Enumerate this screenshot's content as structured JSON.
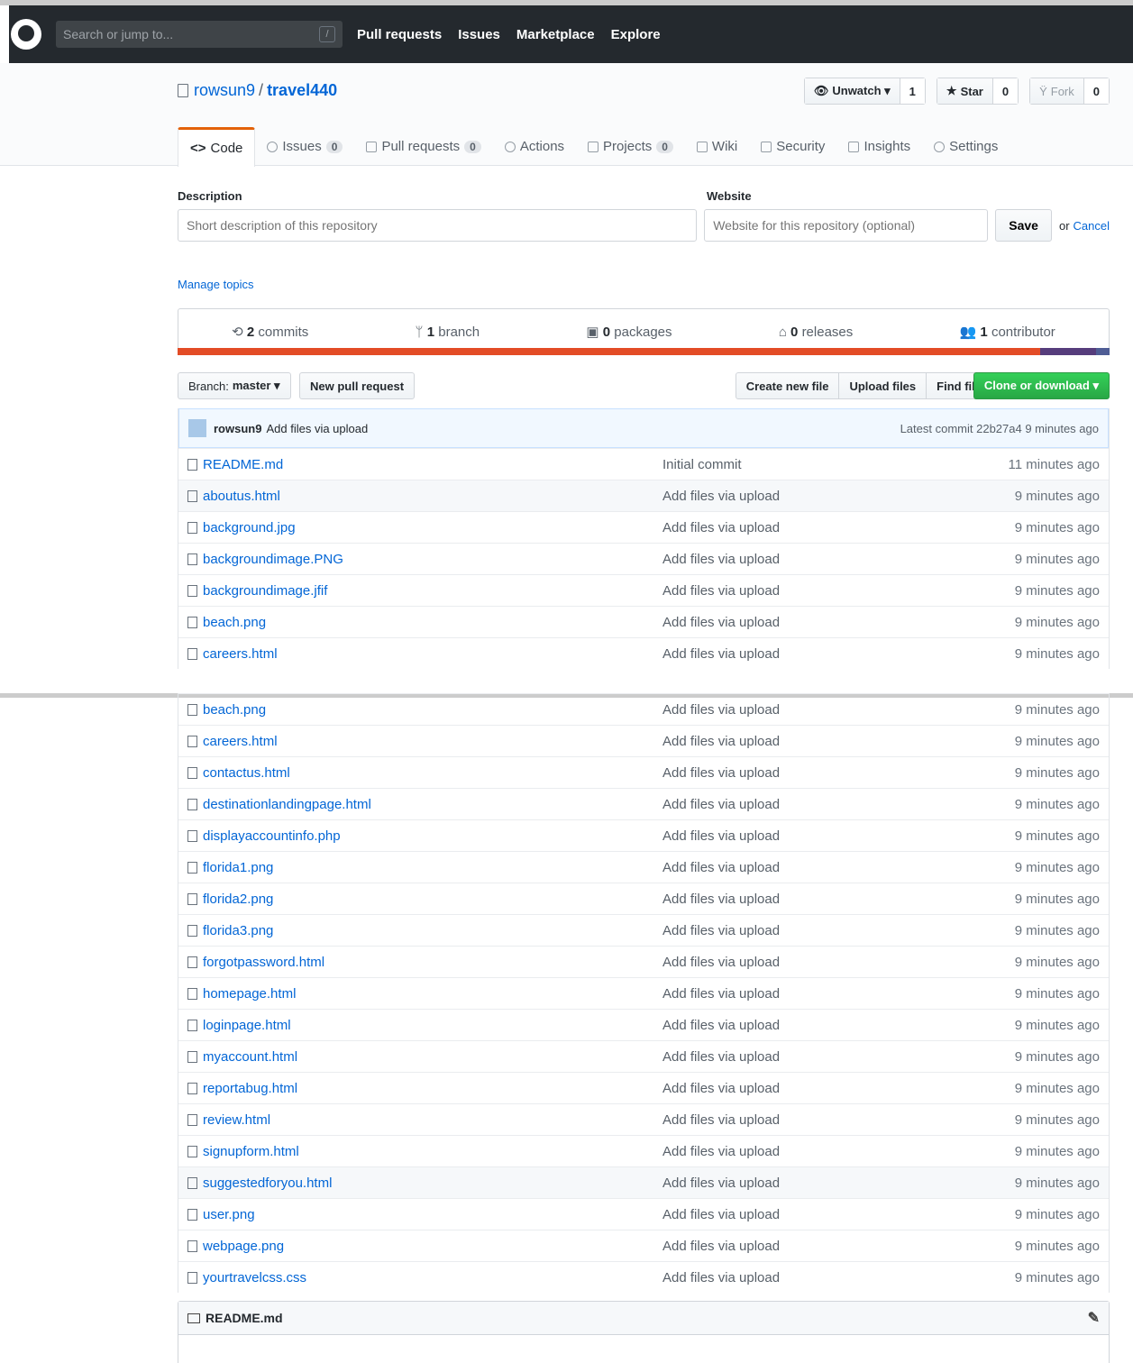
{
  "header": {
    "search_placeholder": "Search or jump to...",
    "slash": "/",
    "nav": [
      "Pull requests",
      "Issues",
      "Marketplace",
      "Explore"
    ]
  },
  "repo": {
    "owner": "rowsun9",
    "sep": "/",
    "name": "travel440",
    "unwatch_label": "Unwatch ▾",
    "watch_count": "1",
    "star_label": "Star",
    "star_count": "0",
    "fork_label": "Fork",
    "fork_count": "0"
  },
  "tabs": [
    {
      "label": "Code",
      "count": ""
    },
    {
      "label": "Issues",
      "count": "0"
    },
    {
      "label": "Pull requests",
      "count": "0"
    },
    {
      "label": "Actions",
      "count": ""
    },
    {
      "label": "Projects",
      "count": "0"
    },
    {
      "label": "Wiki",
      "count": ""
    },
    {
      "label": "Security",
      "count": ""
    },
    {
      "label": "Insights",
      "count": ""
    },
    {
      "label": "Settings",
      "count": ""
    }
  ],
  "description": {
    "desc_label": "Description",
    "desc_placeholder": "Short description of this repository",
    "website_label": "Website",
    "website_placeholder": "Website for this repository (optional)",
    "save_label": "Save",
    "or_text": "or",
    "cancel_label": "Cancel"
  },
  "manage_topics": "Manage topics",
  "summary": {
    "commits_num": "2",
    "commits_label": "commits",
    "branch_num": "1",
    "branch_label": "branch",
    "packages_num": "0",
    "packages_label": "packages",
    "releases_num": "0",
    "releases_label": "releases",
    "contributor_num": "1",
    "contributor_label": "contributor"
  },
  "colors": {
    "lang_red": "#e34c26",
    "lang_purple": "#563d7c",
    "lang_blue": "#4F5D95",
    "accent": "#0366d6"
  },
  "toolbar": {
    "branch_label": "Branch:",
    "branch_value": "master ▾",
    "new_pr": "New pull request",
    "create_file": "Create new file",
    "upload_files": "Upload files",
    "find_file": "Find file",
    "clone": "Clone or download ▾"
  },
  "latest_commit": {
    "user": "rowsun9",
    "message": "Add files via upload",
    "info": "Latest commit 22b27a4 9 minutes ago"
  },
  "files_top": [
    {
      "name": "README.md",
      "message": "Initial commit",
      "age": "11 minutes ago"
    },
    {
      "name": "aboutus.html",
      "message": "Add files via upload",
      "age": "9 minutes ago"
    },
    {
      "name": "background.jpg",
      "message": "Add files via upload",
      "age": "9 minutes ago"
    },
    {
      "name": "backgroundimage.PNG",
      "message": "Add files via upload",
      "age": "9 minutes ago"
    },
    {
      "name": "backgroundimage.jfif",
      "message": "Add files via upload",
      "age": "9 minutes ago"
    },
    {
      "name": "beach.png",
      "message": "Add files via upload",
      "age": "9 minutes ago"
    },
    {
      "name": "careers.html",
      "message": "Add files via upload",
      "age": "9 minutes ago"
    }
  ],
  "files_bottom": [
    {
      "name": "beach.png",
      "message": "Add files via upload",
      "age": "9 minutes ago"
    },
    {
      "name": "careers.html",
      "message": "Add files via upload",
      "age": "9 minutes ago"
    },
    {
      "name": "contactus.html",
      "message": "Add files via upload",
      "age": "9 minutes ago"
    },
    {
      "name": "destinationlandingpage.html",
      "message": "Add files via upload",
      "age": "9 minutes ago"
    },
    {
      "name": "displayaccountinfo.php",
      "message": "Add files via upload",
      "age": "9 minutes ago"
    },
    {
      "name": "florida1.png",
      "message": "Add files via upload",
      "age": "9 minutes ago"
    },
    {
      "name": "florida2.png",
      "message": "Add files via upload",
      "age": "9 minutes ago"
    },
    {
      "name": "florida3.png",
      "message": "Add files via upload",
      "age": "9 minutes ago"
    },
    {
      "name": "forgotpassword.html",
      "message": "Add files via upload",
      "age": "9 minutes ago"
    },
    {
      "name": "homepage.html",
      "message": "Add files via upload",
      "age": "9 minutes ago"
    },
    {
      "name": "loginpage.html",
      "message": "Add files via upload",
      "age": "9 minutes ago"
    },
    {
      "name": "myaccount.html",
      "message": "Add files via upload",
      "age": "9 minutes ago"
    },
    {
      "name": "reportabug.html",
      "message": "Add files via upload",
      "age": "9 minutes ago"
    },
    {
      "name": "review.html",
      "message": "Add files via upload",
      "age": "9 minutes ago"
    },
    {
      "name": "signupform.html",
      "message": "Add files via upload",
      "age": "9 minutes ago"
    },
    {
      "name": "suggestedforyou.html",
      "message": "Add files via upload",
      "age": "9 minutes ago"
    },
    {
      "name": "user.png",
      "message": "Add files via upload",
      "age": "9 minutes ago"
    },
    {
      "name": "webpage.png",
      "message": "Add files via upload",
      "age": "9 minutes ago"
    },
    {
      "name": "yourtravelcss.css",
      "message": "Add files via upload",
      "age": "9 minutes ago"
    }
  ],
  "readme": {
    "title": "README.md",
    "edit_icon": "pencil-icon"
  }
}
